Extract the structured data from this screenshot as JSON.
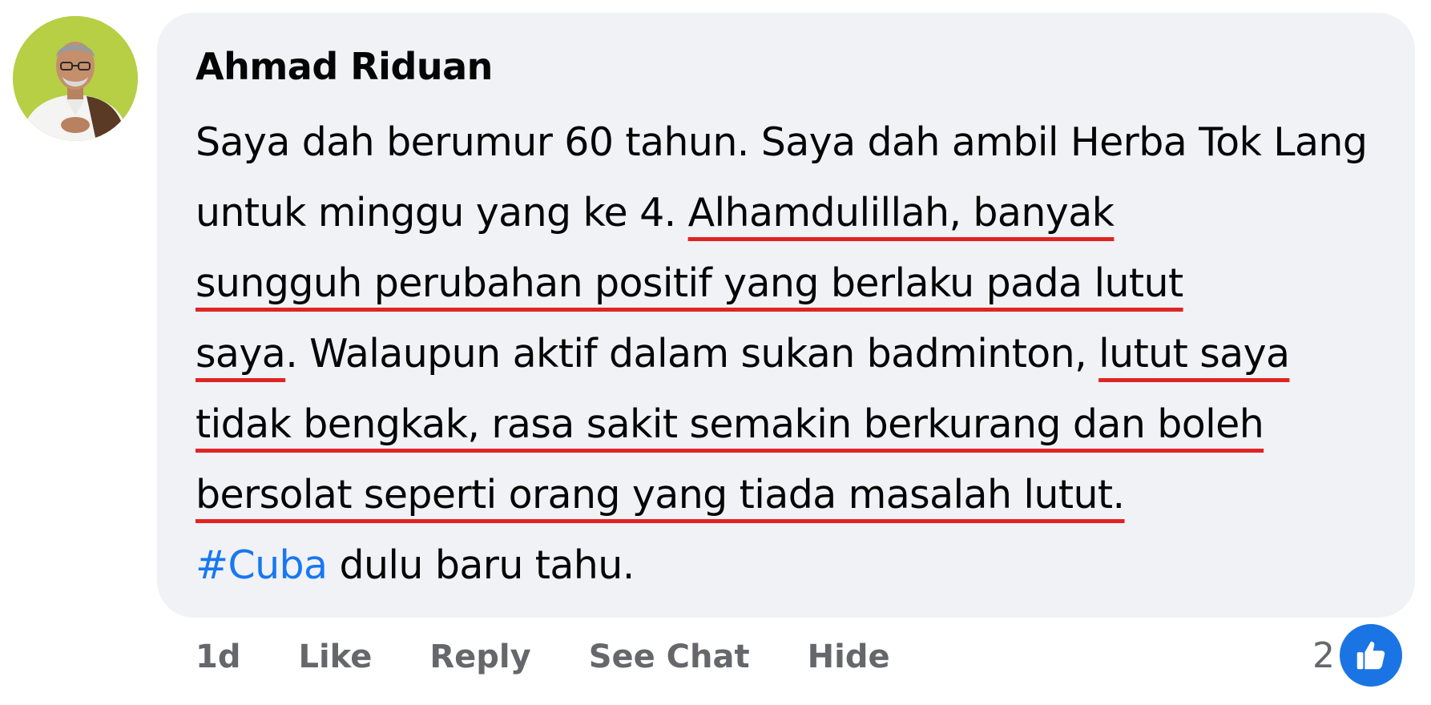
{
  "comment": {
    "author": "Ahmad Riduan",
    "lines": [
      [
        {
          "text": "Saya dah berumur 60 tahun. Saya dah ambil Herba Tok Lang",
          "underlined": false
        }
      ],
      [
        {
          "text": "untuk minggu yang ke 4. ",
          "underlined": false
        },
        {
          "text": "Alhamdulillah, banyak",
          "underlined": true
        }
      ],
      [
        {
          "text": "sungguh perubahan positif yang berlaku pada lutut",
          "underlined": true
        }
      ],
      [
        {
          "text": "saya",
          "underlined": true
        },
        {
          "text": ". Walaupun aktif dalam sukan badminton, ",
          "underlined": false
        },
        {
          "text": "lutut saya",
          "underlined": true
        }
      ],
      [
        {
          "text": "tidak bengkak, rasa sakit semakin berkurang dan boleh",
          "underlined": true
        }
      ],
      [
        {
          "text": "bersolat seperti orang yang tiada masalah lutut.",
          "underlined": true
        }
      ]
    ],
    "hashtag": "#Cuba",
    "tail": " dulu baru tahu."
  },
  "actions": {
    "time": "1d",
    "like": "Like",
    "reply": "Reply",
    "see_chat": "See Chat",
    "hide": "Hide"
  },
  "reactions": {
    "count": "2",
    "icon": "thumbs-up-icon"
  },
  "colors": {
    "bubble_bg": "#f0f2f5",
    "text": "#050505",
    "meta_text": "#65676b",
    "hashtag": "#1877f2",
    "underline": "#e02424",
    "like_badge": "#1b74e4",
    "avatar_bg": "#b6cf45"
  }
}
